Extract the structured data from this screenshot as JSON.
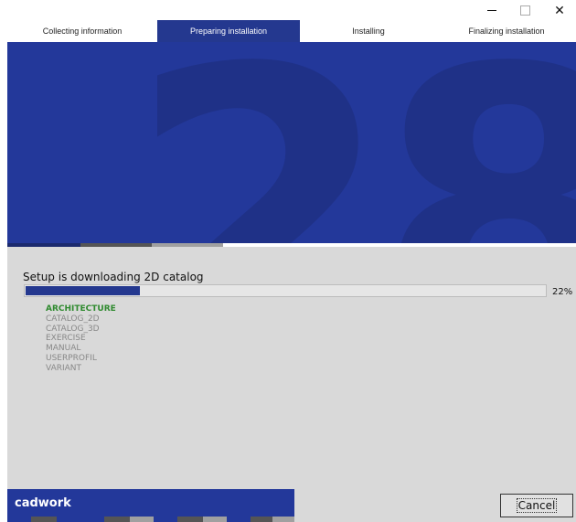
{
  "window": {
    "minimize_icon": "minimize-icon",
    "maximize_icon": "maximize-icon",
    "close_icon": "close-icon",
    "close_glyph": "✕"
  },
  "steps": [
    {
      "label": "Collecting information",
      "active": false
    },
    {
      "label": "Preparing installation",
      "active": true
    },
    {
      "label": "Installing",
      "active": false
    },
    {
      "label": "Finalizing installation",
      "active": false
    }
  ],
  "banner": {
    "graphic_text": "28",
    "background_color": "#23389a",
    "digit_color": "#1f3187"
  },
  "status": {
    "message": "Setup is downloading 2D catalog",
    "progress_percent": 22,
    "percent_label": "22%"
  },
  "items": [
    {
      "label": "ARCHITECTURE",
      "state": "active"
    },
    {
      "label": "CATALOG_2D",
      "state": "pending"
    },
    {
      "label": "CATALOG_3D",
      "state": "pending"
    },
    {
      "label": "EXERCISE",
      "state": "pending"
    },
    {
      "label": "MANUAL",
      "state": "pending"
    },
    {
      "label": "USERPROFIL",
      "state": "pending"
    },
    {
      "label": "VARIANT",
      "state": "pending"
    }
  ],
  "footer": {
    "brand": "cadwork",
    "cancel_label": "Cancel"
  },
  "colors": {
    "accent": "#24388f",
    "panel": "#d9d9d9",
    "active_item": "#2f8a2f",
    "pending_item": "#888888"
  }
}
